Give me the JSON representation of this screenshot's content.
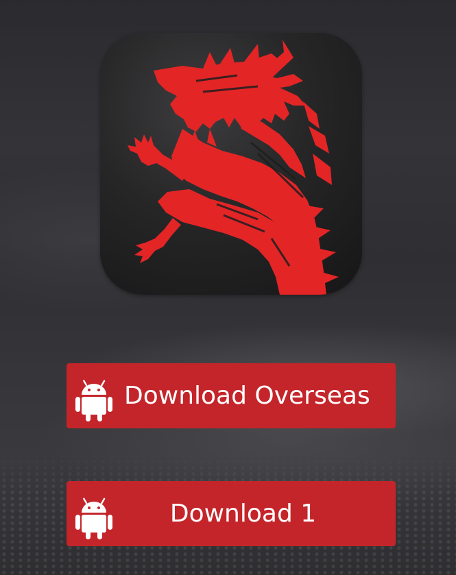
{
  "app": {
    "icon": "red-dragon-logo"
  },
  "buttons": [
    {
      "label": "Download Overseas",
      "icon": "android-icon"
    },
    {
      "label": "Download 1",
      "icon": "android-icon"
    }
  ],
  "colors": {
    "button_red": "#c4252a",
    "dragon_red": "#e32526",
    "icon_dark": "#1e1e1f"
  }
}
